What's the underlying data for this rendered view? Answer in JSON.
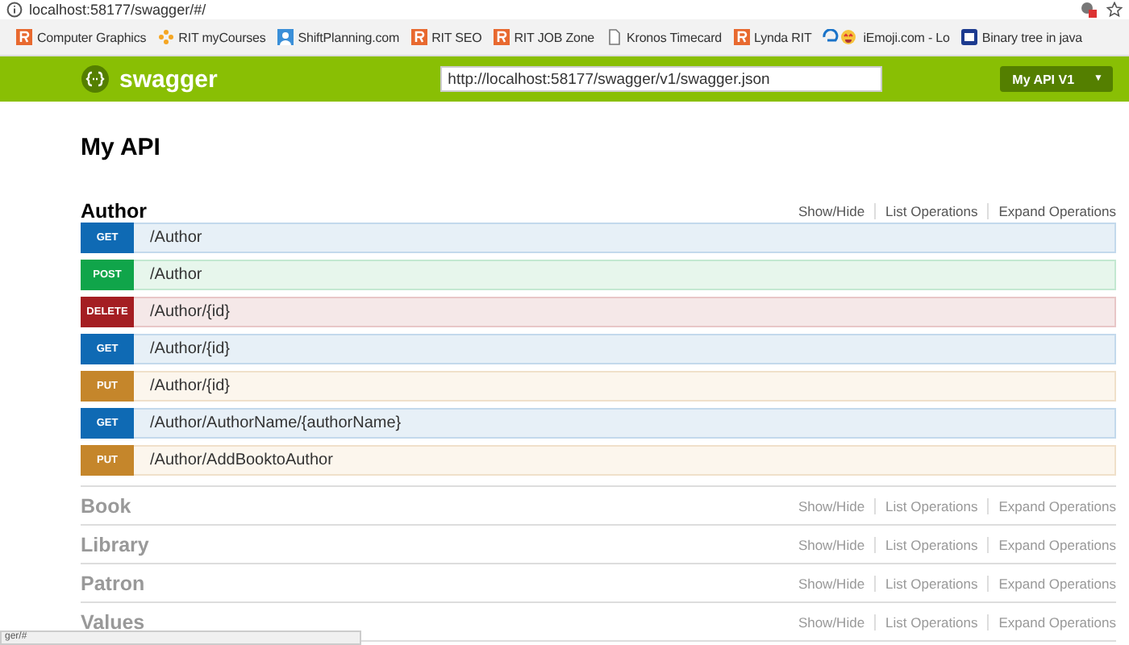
{
  "browser": {
    "url": "localhost:58177/swagger/#/",
    "bookmarks": [
      {
        "label": "Computer Graphics",
        "kind": "r"
      },
      {
        "label": "RIT myCourses",
        "kind": "pinwheel"
      },
      {
        "label": "ShiftPlanning.com",
        "kind": "person"
      },
      {
        "label": "RIT SEO",
        "kind": "r"
      },
      {
        "label": "RIT JOB Zone",
        "kind": "r"
      },
      {
        "label": "Kronos Timecard",
        "kind": "page"
      },
      {
        "label": "Lynda RIT",
        "kind": "r"
      },
      {
        "label": "iEmoji.com - Lo",
        "kind": "emoji"
      },
      {
        "label": "Binary tree in java",
        "kind": "ad"
      }
    ],
    "status": "ger/#"
  },
  "header": {
    "logo": "swagger",
    "url_value": "http://localhost:58177/swagger/v1/swagger.json",
    "api_select": "My API V1",
    "caret": "▼"
  },
  "title": "My API",
  "sections": [
    {
      "name": "Author",
      "expanded": true,
      "links": [
        "Show/Hide",
        "List Operations",
        "Expand Operations"
      ],
      "operations": [
        {
          "method": "GET",
          "path": "/Author"
        },
        {
          "method": "POST",
          "path": "/Author"
        },
        {
          "method": "DELETE",
          "path": "/Author/{id}"
        },
        {
          "method": "GET",
          "path": "/Author/{id}"
        },
        {
          "method": "PUT",
          "path": "/Author/{id}"
        },
        {
          "method": "GET",
          "path": "/Author/AuthorName/{authorName}"
        },
        {
          "method": "PUT",
          "path": "/Author/AddBooktoAuthor"
        }
      ]
    },
    {
      "name": "Book",
      "expanded": false,
      "links": [
        "Show/Hide",
        "List Operations",
        "Expand Operations"
      ]
    },
    {
      "name": "Library",
      "expanded": false,
      "links": [
        "Show/Hide",
        "List Operations",
        "Expand Operations"
      ]
    },
    {
      "name": "Patron",
      "expanded": false,
      "links": [
        "Show/Hide",
        "List Operations",
        "Expand Operations"
      ]
    },
    {
      "name": "Values",
      "expanded": false,
      "links": [
        "Show/Hide",
        "List Operations",
        "Expand Operations"
      ]
    }
  ]
}
